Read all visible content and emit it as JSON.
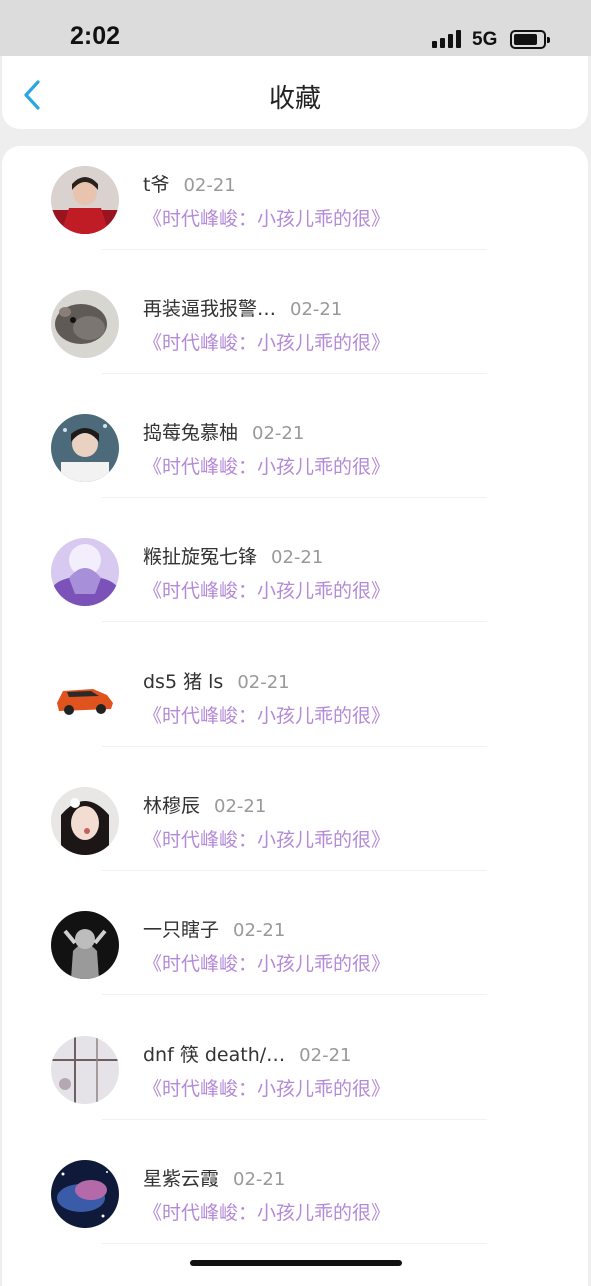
{
  "status_bar": {
    "time": "2:02",
    "network": "5G"
  },
  "header": {
    "title": "收藏"
  },
  "favorites": [
    {
      "name": "t爷",
      "date": "02-21",
      "title": "《时代峰峻：小孩儿乖的很》",
      "avatar": "red-jacket-boy-avatar"
    },
    {
      "name": "再装逼我报警…",
      "date": "02-21",
      "title": "《时代峰峻：小孩儿乖的很》",
      "avatar": "hamster-avatar"
    },
    {
      "name": "捣莓兔慕柚",
      "date": "02-21",
      "title": "《时代峰峻：小孩儿乖的很》",
      "avatar": "boy-portrait-avatar"
    },
    {
      "name": "糇扯旋冤七锋",
      "date": "02-21",
      "title": "《时代峰峻：小孩儿乖的很》",
      "avatar": "purple-anime-avatar"
    },
    {
      "name": "ds5 猪 ls",
      "date": "02-21",
      "title": "《时代峰峻：小孩儿乖的很》",
      "avatar": "orange-toy-car-avatar"
    },
    {
      "name": "林穆辰",
      "date": "02-21",
      "title": "《时代峰峻：小孩儿乖的很》",
      "avatar": "girl-portrait-avatar"
    },
    {
      "name": "一只瞎子",
      "date": "02-21",
      "title": "《时代峰峻：小孩儿乖的很》",
      "avatar": "dark-sketch-avatar"
    },
    {
      "name": "dnf 筷 death/…",
      "date": "02-21",
      "title": "《时代峰峻：小孩儿乖的很》",
      "avatar": "window-grid-avatar"
    },
    {
      "name": "星紫云霞",
      "date": "02-21",
      "title": "《时代峰峻：小孩儿乖的很》",
      "avatar": "galaxy-avatar"
    }
  ],
  "colors": {
    "accent": "#2aa6e0",
    "title_purple": "#b48ad8"
  }
}
